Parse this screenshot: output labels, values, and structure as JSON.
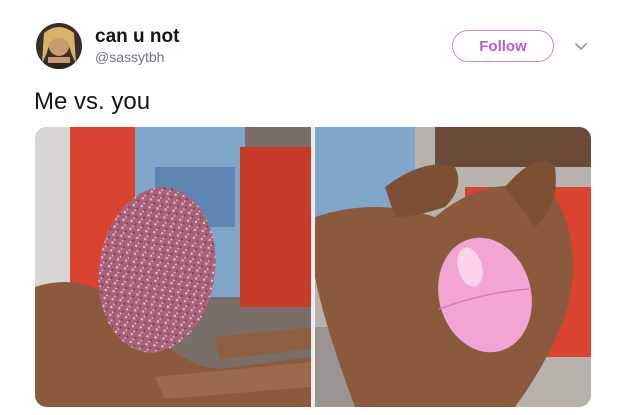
{
  "tweet": {
    "author_name": "can u not",
    "author_handle": "@sassytbh",
    "follow_label": "Follow",
    "text": "Me vs. you"
  },
  "icons": {
    "avatar": "profile-photo",
    "menu": "chevron-down-icon"
  },
  "media": {
    "images": [
      {
        "description": "hand-holding-glitter-egg"
      },
      {
        "description": "hand-holding-pink-plastic-egg"
      }
    ]
  },
  "colors": {
    "follow_accent": "#b45fd0",
    "name": "#14171a",
    "handle": "#657786"
  }
}
